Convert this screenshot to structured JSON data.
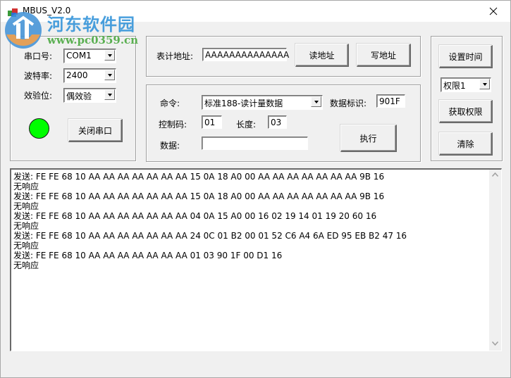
{
  "window": {
    "title": "MBUS_V2.0",
    "close_icon": "close-icon"
  },
  "serial": {
    "port_label": "串口号:",
    "port_value": "COM1",
    "baud_label": "波特率:",
    "baud_value": "2400",
    "parity_label": "效验位:",
    "parity_value": "偶效验",
    "status_led_color": "#00ff00",
    "close_port_button": "关闭串口"
  },
  "address": {
    "label": "表计地址:",
    "value": "AAAAAAAAAAAAAA",
    "read_button": "读地址",
    "write_button": "写地址"
  },
  "command": {
    "command_label": "命令:",
    "command_value": "标准188-读计量数据",
    "data_id_label": "数据标识:",
    "data_id_value": "901F",
    "control_code_label": "控制码:",
    "control_code_value": "01",
    "length_label": "长度:",
    "length_value": "03",
    "data_label": "数据:",
    "data_value": "",
    "execute_button": "执行"
  },
  "right_panel": {
    "set_time_button": "设置时间",
    "permission_value": "权限1",
    "get_permission_button": "获取权限",
    "clear_button": "清除"
  },
  "log": {
    "lines": [
      "发送: FE FE 68 10 AA AA AA AA AA AA AA 15 0A 18 A0 00 AA AA AA AA AA AA AA 9B 16",
      "无响应",
      "发送: FE FE 68 10 AA AA AA AA AA AA AA 15 0A 18 A0 00 AA AA AA AA AA AA AA 9B 16",
      "无响应",
      "发送: FE FE 68 10 AA AA AA AA AA AA AA 04 0A 15 A0 00 16 02 19 14 01 19 20 60 16",
      "无响应",
      "发送: FE FE 68 10 AA AA AA AA AA AA AA 24 0C 01 B2 00 01 52 C6 A4 6A ED 95 EB B2 47 16",
      "无响应",
      "发送: FE FE 68 10 AA AA AA AA AA AA AA 01 03 90 1F 00 D1 16",
      "无响应"
    ]
  },
  "watermark": {
    "name": "河东软件园",
    "url": "www.pc0359.cn"
  }
}
